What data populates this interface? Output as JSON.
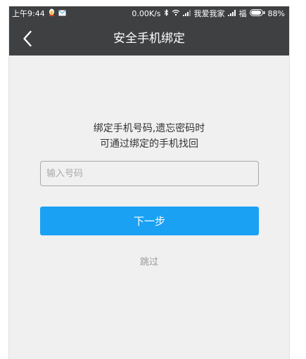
{
  "status_bar": {
    "time": "上午9:44",
    "net_speed": "0.00K/s",
    "carrier_1": "我爱我家",
    "carrier_2": "福",
    "battery": "88%"
  },
  "header": {
    "title": "安全手机绑定",
    "back_icon": "chevron-left-icon"
  },
  "main": {
    "description_line1": "绑定手机号码,遗忘密码时",
    "description_line2": "可通过绑定的手机找回",
    "phone_placeholder": "输入号码",
    "phone_value": "",
    "next_label": "下一步",
    "skip_label": "跳过"
  },
  "colors": {
    "header_bg": "#3e4042",
    "page_bg": "#f0f0f0",
    "primary": "#1aa1f4",
    "skip_text": "#999999"
  }
}
